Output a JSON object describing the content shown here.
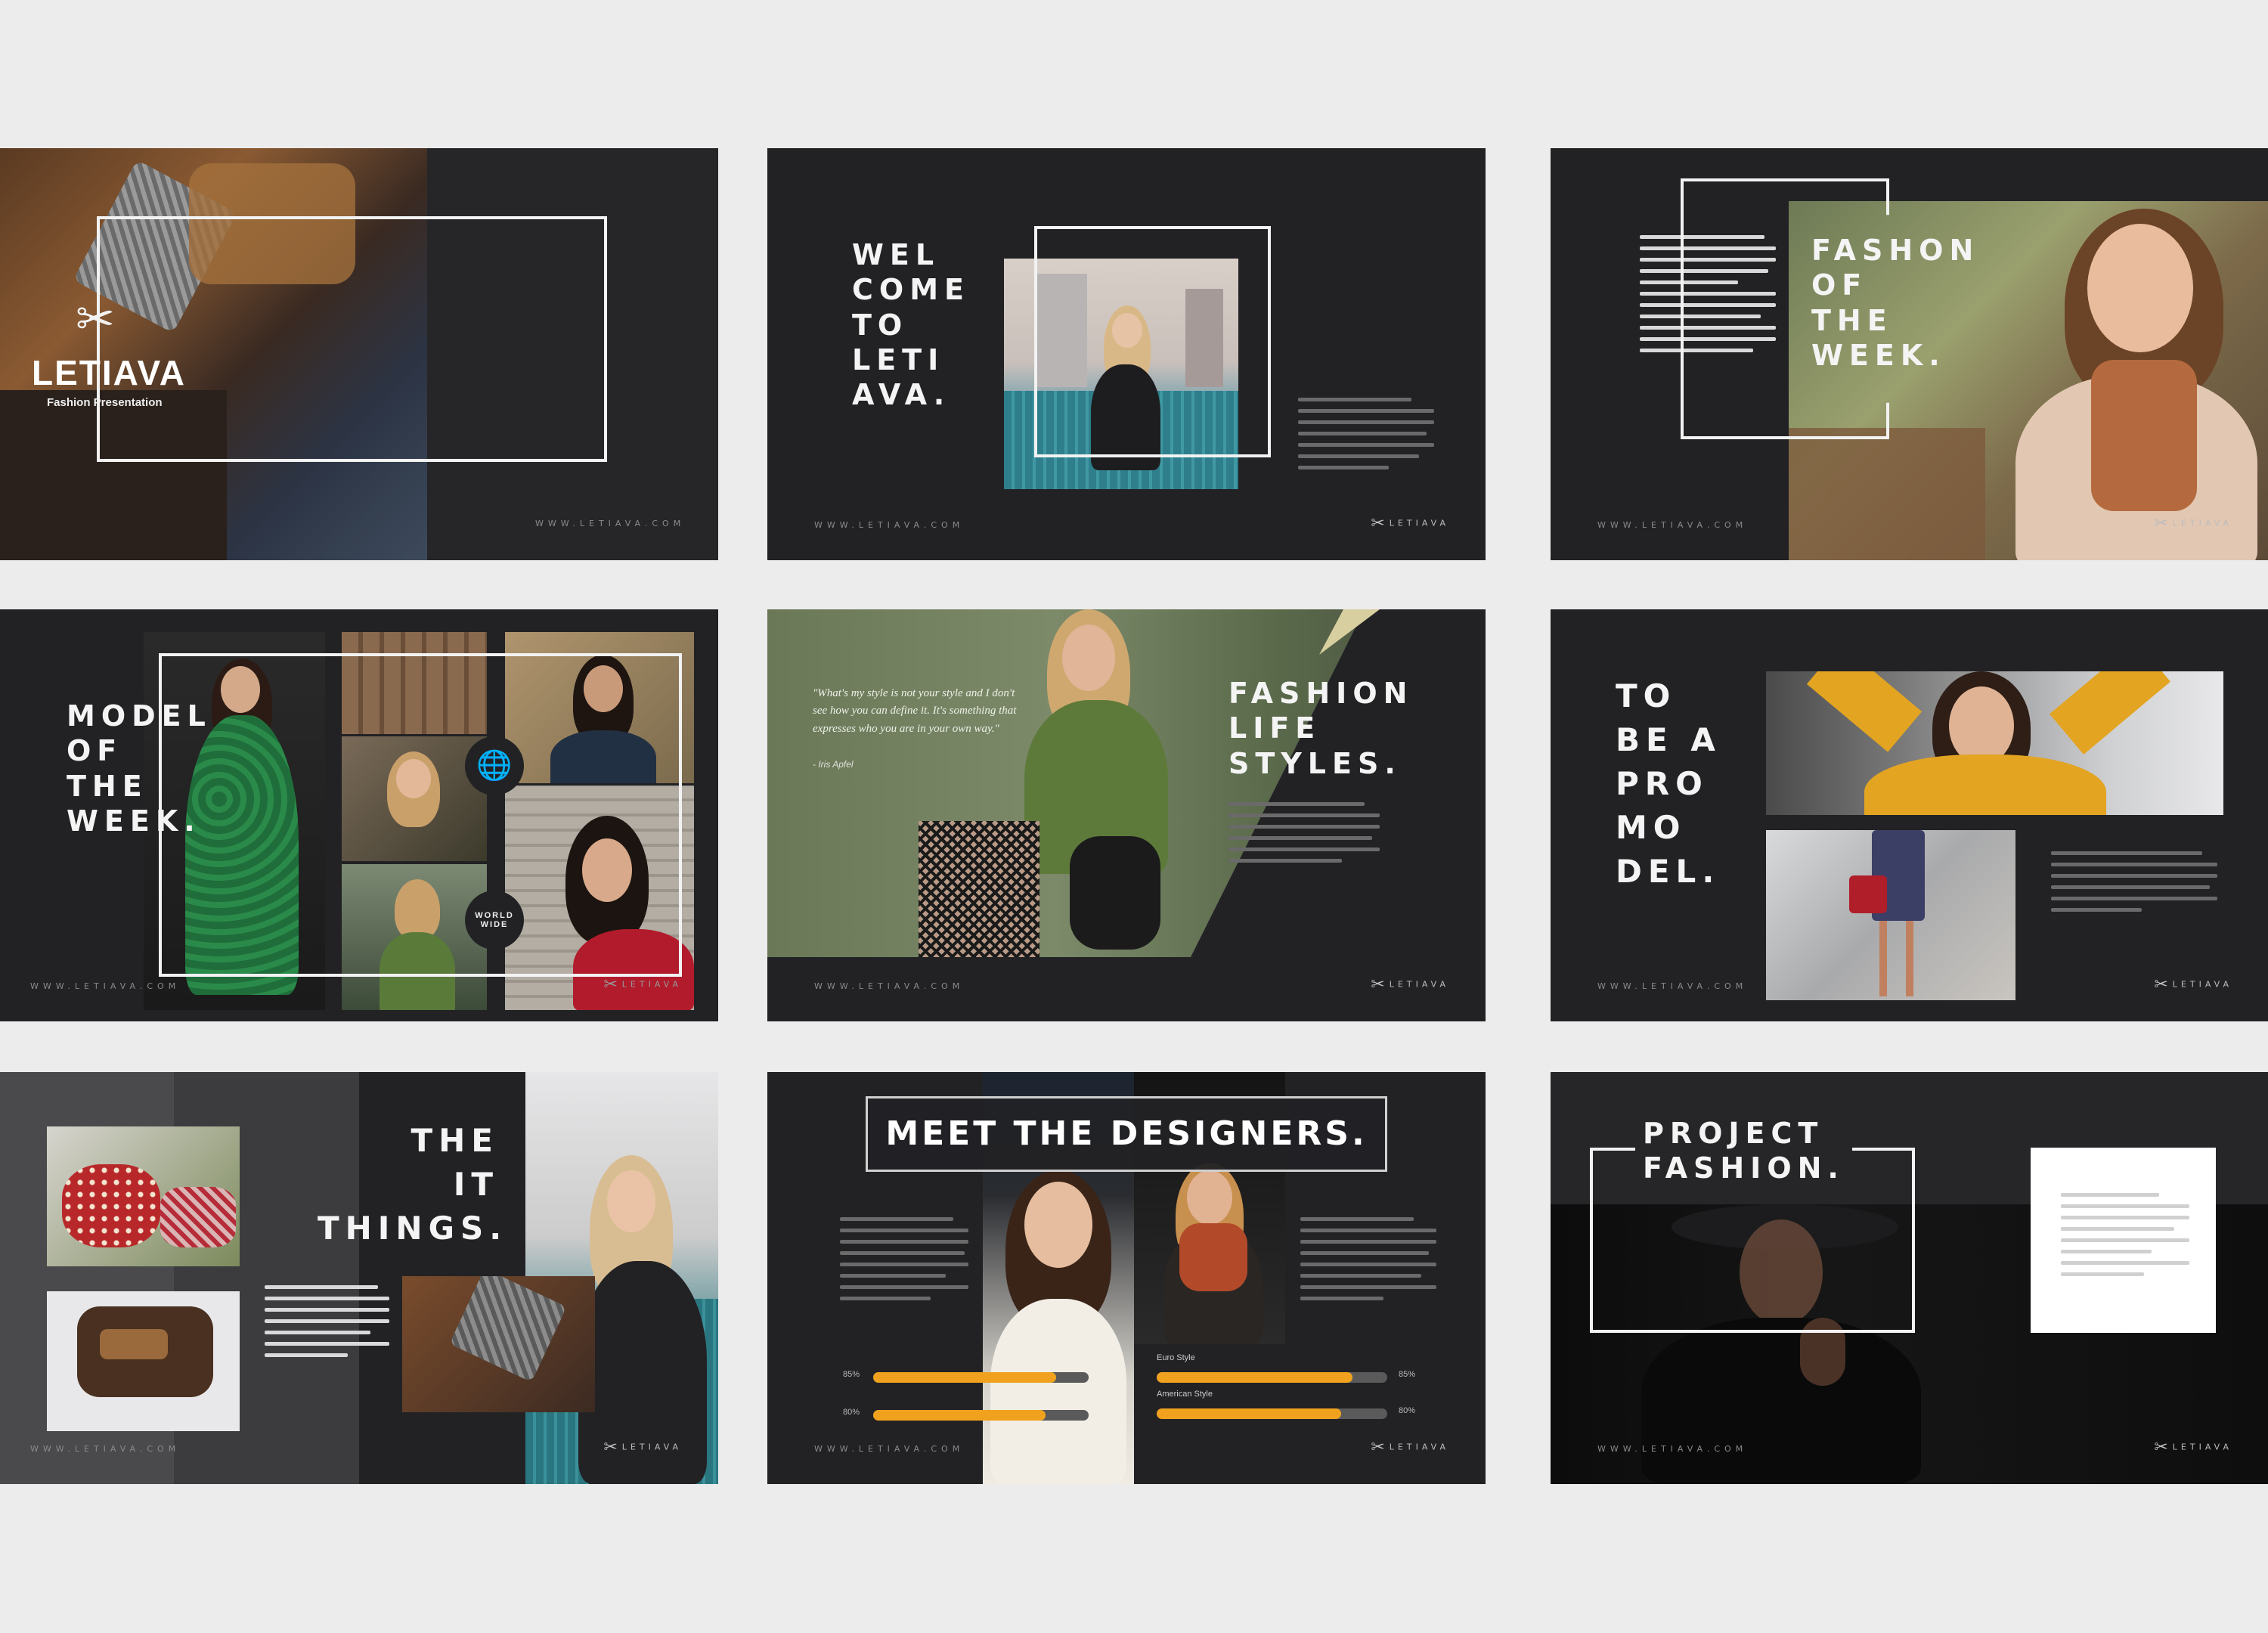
{
  "slide1": {
    "logo": "LETIAVA",
    "subtitle": "Fashion Presentation",
    "url": "WWW.LETIAVA.COM"
  },
  "slide2": {
    "title": "WEL\nCOME\nTO\nLETI\nAVA.",
    "url": "WWW.LETIAVA.COM",
    "brand": "LETIAVA"
  },
  "slide3": {
    "title": "FASHON\nOF\nTHE\nWEEK.",
    "url": "WWW.LETIAVA.COM",
    "brand": "LETIAVA"
  },
  "slide4": {
    "title": "MODEL\nOF\nTHE\nWEEK.",
    "badge": "WORLD\nWIDE",
    "url": "WWW.LETIAVA.COM",
    "brand": "LETIAVA"
  },
  "slide5": {
    "title": "FASHION\nLIFE\nSTYLES.",
    "quote": "\"What's my style is not your style and I don't see how you can define it. It's something that expresses who you are in your own way.\"",
    "quote_author": "- Iris Apfel",
    "url": "WWW.LETIAVA.COM",
    "brand": "LETIAVA"
  },
  "slide6": {
    "title": "TO\nBE A\nPRO\nMO\nDEL.",
    "url": "WWW.LETIAVA.COM",
    "brand": "LETIAVA"
  },
  "slide7": {
    "title": "THE\nIT\nTHINGS.",
    "url": "WWW.LETIAVA.COM",
    "brand": "LETIAVA"
  },
  "slide8": {
    "title": "MEET THE DESIGNERS.",
    "url": "WWW.LETIAVA.COM",
    "brand": "LETIAVA",
    "bars_left": [
      {
        "label": "",
        "pct_label": "85%",
        "value": 0.85
      },
      {
        "label": "",
        "pct_label": "80%",
        "value": 0.8
      }
    ],
    "bars_right": [
      {
        "label": "Euro Style",
        "pct_label": "85%",
        "value": 0.85
      },
      {
        "label": "American Style",
        "pct_label": "80%",
        "value": 0.8
      }
    ],
    "colors": {
      "bar_fill": "#f0a21e",
      "bar_track": "#5a5a5a"
    }
  },
  "slide9": {
    "title": "PROJECT\nFASHION.",
    "url": "WWW.LETIAVA.COM",
    "brand": "LETIAVA"
  }
}
